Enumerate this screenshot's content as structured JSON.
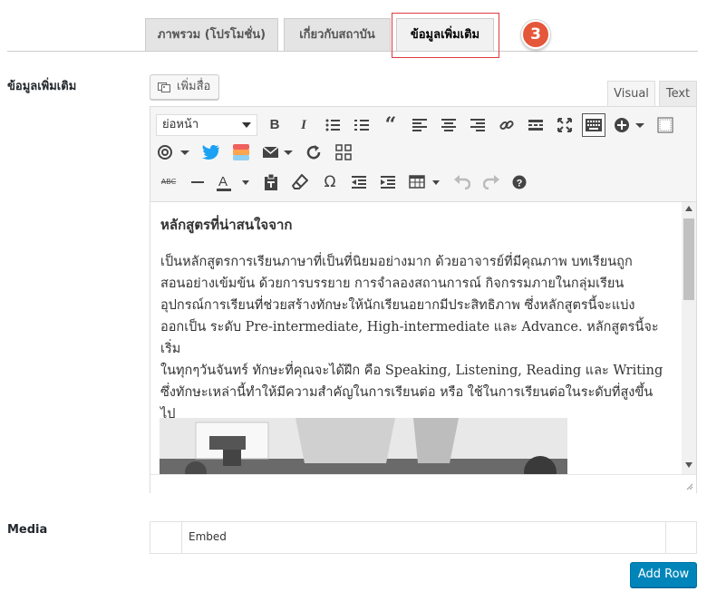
{
  "tabs": [
    {
      "label": "ภาพรวม (โปรโมชั่น)"
    },
    {
      "label": "เกี่ยวกับสถาบัน"
    },
    {
      "label": "ข้อมูลเพิ่มเติม"
    }
  ],
  "step_badge": "3",
  "section": {
    "label": "ข้อมูลเพิ่มเติม"
  },
  "add_media_label": "เพิ่มสื่อ",
  "editor_tabs": {
    "visual": "Visual",
    "text": "Text"
  },
  "format_select": {
    "selected": "ย่อหน้า"
  },
  "toolbar_icons": [
    "bold-icon",
    "italic-icon",
    "bullet-list-icon",
    "numbered-list-icon",
    "blockquote-icon",
    "align-left-icon",
    "align-center-icon",
    "align-right-icon",
    "link-icon",
    "read-more-icon",
    "fullscreen-icon",
    "toolbar-toggle-icon",
    "insert-plus-icon",
    "preview-icon",
    "mention-icon",
    "twitter-icon",
    "color-block-icon",
    "email-icon",
    "refresh-icon",
    "grid-icon",
    "strikethrough-icon",
    "horizontal-line-icon",
    "text-color-icon",
    "paste-text-icon",
    "clear-formatting-icon",
    "omega-icon",
    "outdent-icon",
    "indent-icon",
    "table-icon",
    "undo-icon",
    "redo-icon",
    "help-icon"
  ],
  "content": {
    "heading": "หลักสูตรที่น่าสนใจจาก",
    "lines": [
      "เป็นหลักสูตรการเรียนภาษาที่เป็นที่นิยมอย่างมาก ด้วยอาจารย์ที่มีคุณภาพ บทเรียนถูก",
      "สอนอย่างเข้มข้น ด้วยการบรรยาย การจำลองสถานการณ์ กิจกรรมภายในกลุ่มเรียน",
      "อุปกรณ์การเรียนที่ช่วยสร้างทักษะให้นักเรียนอยากมีประสิทธิภาพ ซึ่งหลักสูตรนี้จะแบ่ง",
      "ออกเป็น ระดับ Pre-intermediate, High-intermediate และ Advance. หลักสูตรนี้จะเริ่ม",
      "ในทุกๆวันจันทร์ ทักษะที่คุณจะได้ฝึก คือ Speaking, Listening, Reading และ Writing",
      "ซึ่งทักษะเหล่านี้ทำให้มีความสำคัญในการเรียนต่อ หรือ ใช้ในการเรียนต่อในระดับที่สูงขึ้น",
      "ไป"
    ]
  },
  "media": {
    "label": "Media",
    "embed_label": "Embed"
  },
  "add_row_label": "Add Row",
  "colors": {
    "accent": "#0085ba",
    "highlight": "#e0393e",
    "badge": "#e5573a"
  }
}
